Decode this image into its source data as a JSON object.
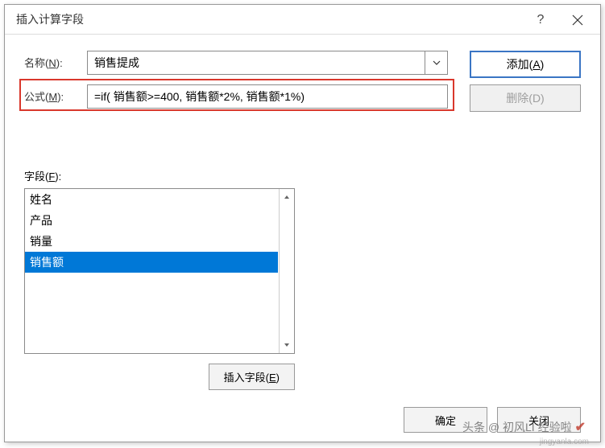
{
  "dialog": {
    "title": "插入计算字段",
    "help": "?",
    "name_label": "名称(N):",
    "name_value": "销售提成",
    "formula_label": "公式(M):",
    "formula_value": "=if( 销售额>=400, 销售额*2%, 销售额*1%)",
    "fields_label": "字段(F):",
    "add_btn": "添加(A)",
    "delete_btn": "删除(D)",
    "insert_field_btn": "插入字段(E)",
    "ok_btn": "确定",
    "close_btn": "关闭"
  },
  "fields": {
    "items": [
      "姓名",
      "产品",
      "销量",
      "销售额"
    ],
    "selected_index": 3
  },
  "watermark": {
    "text": "头条 @ 初风LI 经验啦",
    "sub": "jingyanla.com"
  }
}
